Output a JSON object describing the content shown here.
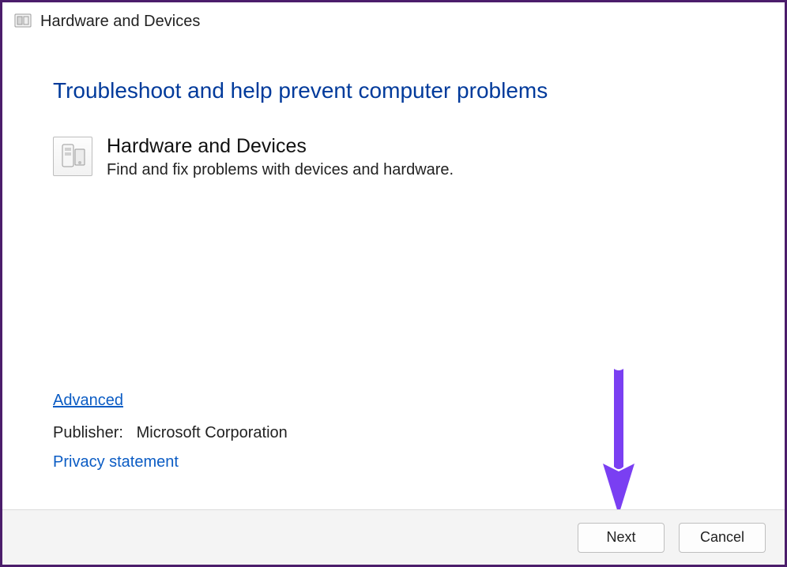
{
  "window": {
    "title": "Hardware and Devices"
  },
  "page": {
    "heading": "Troubleshoot and help prevent computer problems"
  },
  "category": {
    "title": "Hardware and Devices",
    "description": "Find and fix problems with devices and hardware."
  },
  "links": {
    "advanced": "Advanced",
    "privacy": "Privacy statement"
  },
  "publisher": {
    "label": "Publisher:",
    "value": "Microsoft Corporation"
  },
  "footer": {
    "next": "Next",
    "cancel": "Cancel"
  },
  "annotation": {
    "arrow_color": "#7a3ff2"
  }
}
